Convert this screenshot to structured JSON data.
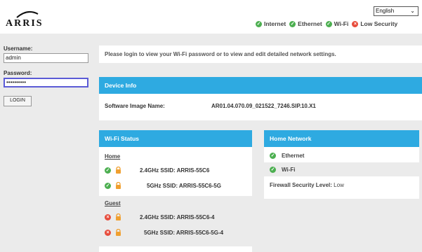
{
  "brand": {
    "logo_text": "ARRIS"
  },
  "language": {
    "selected": "English",
    "chevron": "⌄"
  },
  "status": [
    {
      "label": "Internet",
      "state": "ok",
      "icon": "check-icon"
    },
    {
      "label": "Ethernet",
      "state": "ok",
      "icon": "check-icon"
    },
    {
      "label": "Wi-Fi",
      "state": "ok",
      "icon": "check-icon"
    },
    {
      "label": "Low Security",
      "state": "bad",
      "icon": "x-icon"
    }
  ],
  "login": {
    "username_label": "Username:",
    "username_value": "admin",
    "password_label": "Password:",
    "password_value": "••••••••••",
    "button_label": "LOGIN"
  },
  "notice": "Please login to view your Wi-Fi password or to view and edit detailed network settings.",
  "device_info": {
    "title": "Device Info",
    "software_label": "Software Image Name:",
    "software_value": "AR01.04.070.09_021522_7246.SIP.10.X1"
  },
  "wifi_status": {
    "title": "Wi-Fi Status",
    "home_label": "Home",
    "home": [
      {
        "ssid": "2.4GHz SSID: ARRIS-55C6",
        "state": "ok"
      },
      {
        "ssid": "5GHz SSID: ARRIS-55C6-5G",
        "state": "ok"
      }
    ],
    "guest_label": "Guest",
    "guest": [
      {
        "ssid": "2.4GHz SSID: ARRIS-55C6-4",
        "state": "bad"
      },
      {
        "ssid": "5GHz SSID: ARRIS-55C6-5G-4",
        "state": "bad"
      }
    ]
  },
  "home_network": {
    "title": "Home Network",
    "items": [
      {
        "label": "Ethernet",
        "state": "ok"
      },
      {
        "label": "Wi-Fi",
        "state": "ok"
      }
    ],
    "firewall_label": "Firewall Security Level:",
    "firewall_value": "Low"
  },
  "colors": {
    "accent": "#2eaae1",
    "ok": "#4caf50",
    "bad": "#e74c3c",
    "lock": "#f0a030"
  }
}
